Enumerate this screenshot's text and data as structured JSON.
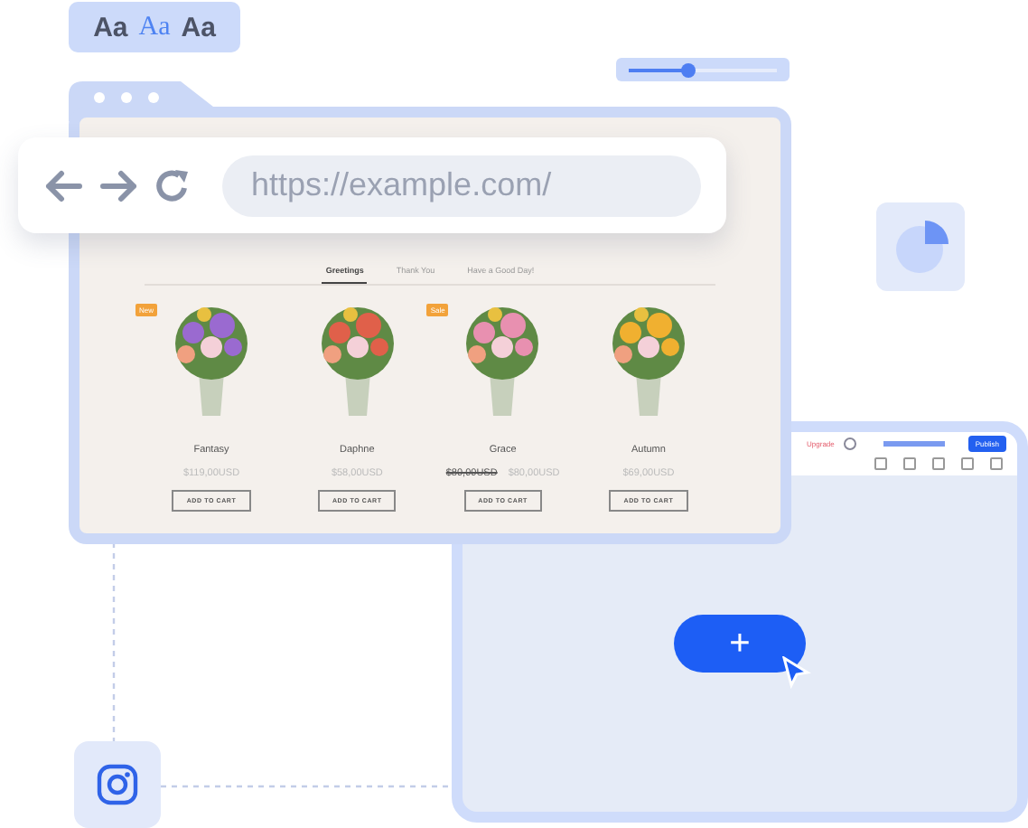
{
  "font_styles": [
    {
      "label": "Aa",
      "selected": false,
      "kind": "sans"
    },
    {
      "label": "Aa",
      "selected": true,
      "kind": "serif"
    },
    {
      "label": "Aa",
      "selected": false,
      "kind": "sans"
    }
  ],
  "size_slider": {
    "level": 0.4
  },
  "address_bar": {
    "url": "https://example.com/"
  },
  "store": {
    "tabs": [
      {
        "label": "Greetings",
        "selected": true
      },
      {
        "label": "Thank You",
        "selected": false
      },
      {
        "label": "Have a Good Day!",
        "selected": false
      }
    ],
    "products": [
      {
        "name": "Fantasy",
        "badge": "New",
        "price": "$119,00USD",
        "button": "ADD TO CART",
        "color": "#9a6ad0"
      },
      {
        "name": "Daphne",
        "price": "$58,00USD",
        "button": "ADD TO CART",
        "color": "#e0604a"
      },
      {
        "name": "Grace",
        "badge": "Sale",
        "old_price": "$80,00USD",
        "price": "$80,00USD",
        "button": "ADD TO CART",
        "color": "#e890b0"
      },
      {
        "name": "Autumn",
        "price": "$69,00USD",
        "button": "ADD TO CART",
        "color": "#f0b030"
      }
    ]
  },
  "editor": {
    "upgrade": "Upgrade",
    "publish": "Publish"
  },
  "add_button": {
    "label": "+"
  }
}
